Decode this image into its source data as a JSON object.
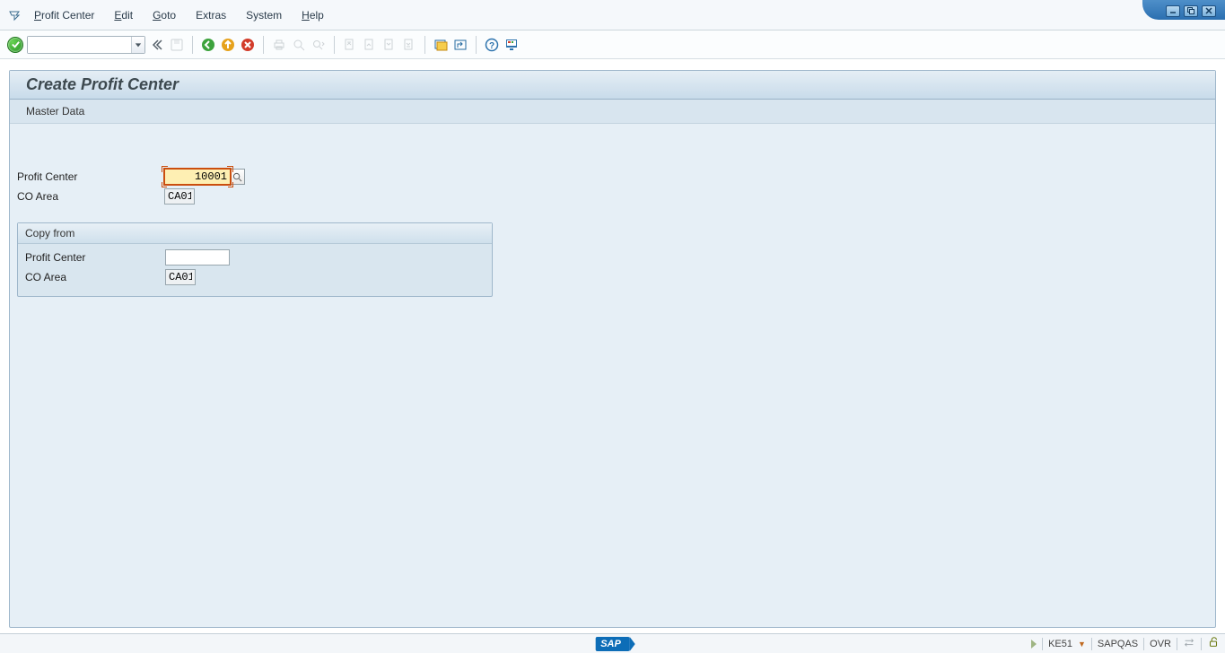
{
  "menu": {
    "items": [
      {
        "text": "Profit Center",
        "ul": "P"
      },
      {
        "text": "Edit",
        "ul": "E"
      },
      {
        "text": "Goto",
        "ul": "G"
      },
      {
        "text": "Extras",
        "ul": ""
      },
      {
        "text": "System",
        "ul": ""
      },
      {
        "text": "Help",
        "ul": "H"
      }
    ]
  },
  "page": {
    "title": "Create Profit Center",
    "subnav": "Master Data"
  },
  "form": {
    "profit_center_label": "Profit Center",
    "profit_center_value": "10001",
    "co_area_label": "CO Area",
    "co_area_value": "CA01"
  },
  "copy_from": {
    "head": "Copy from",
    "profit_center_label": "Profit Center",
    "profit_center_value": "",
    "co_area_label": "CO Area",
    "co_area_value": "CA01"
  },
  "status": {
    "tcode": "KE51",
    "system": "SAPQAS",
    "mode": "OVR",
    "logo": "SAP"
  }
}
